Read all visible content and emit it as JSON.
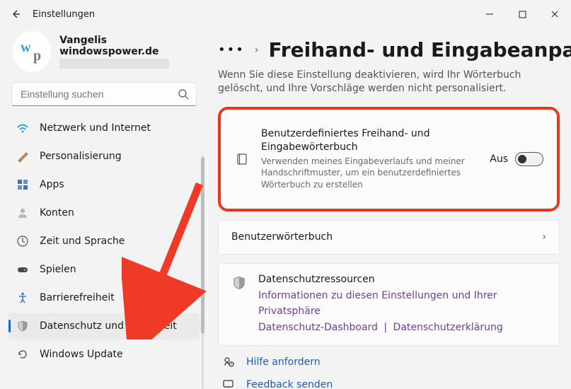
{
  "window": {
    "title": "Einstellungen"
  },
  "profile": {
    "name": "Vangelis windowspower.de",
    "avatar_text_top": "w",
    "avatar_text_bottom": "p"
  },
  "search": {
    "placeholder": "Einstellung suchen"
  },
  "sidebar": {
    "items": [
      {
        "label": "Netzwerk und Internet"
      },
      {
        "label": "Personalisierung"
      },
      {
        "label": "Apps"
      },
      {
        "label": "Konten"
      },
      {
        "label": "Zeit und Sprache"
      },
      {
        "label": "Spielen"
      },
      {
        "label": "Barrierefreiheit"
      },
      {
        "label": "Datenschutz und Sicherheit"
      },
      {
        "label": "Windows Update"
      }
    ]
  },
  "main": {
    "page_title": "Freihand- und Eingabeanpassung",
    "page_desc": "Wenn Sie diese Einstellung deaktivieren, wird Ihr Wörterbuch gelöscht, und Ihre Vorschläge werden nicht personalisiert.",
    "dict_card": {
      "title": "Benutzerdefiniertes Freihand- und Eingabewörterbuch",
      "sub": "Verwenden meines Eingabeverlaufs und meiner Handschriftmuster, um ein benutzerdefiniertes Wörterbuch zu erstellen",
      "toggle_label": "Aus"
    },
    "user_dict_label": "Benutzerwörterbuch",
    "resources": {
      "title": "Datenschutzressourcen",
      "link1": "Informationen zu diesen Einstellungen und Ihrer Privatsphäre",
      "link2": "Datenschutz-Dashboard",
      "link3": "Datenschutzerklärung"
    },
    "help_label": "Hilfe anfordern",
    "feedback_label": "Feedback senden"
  }
}
